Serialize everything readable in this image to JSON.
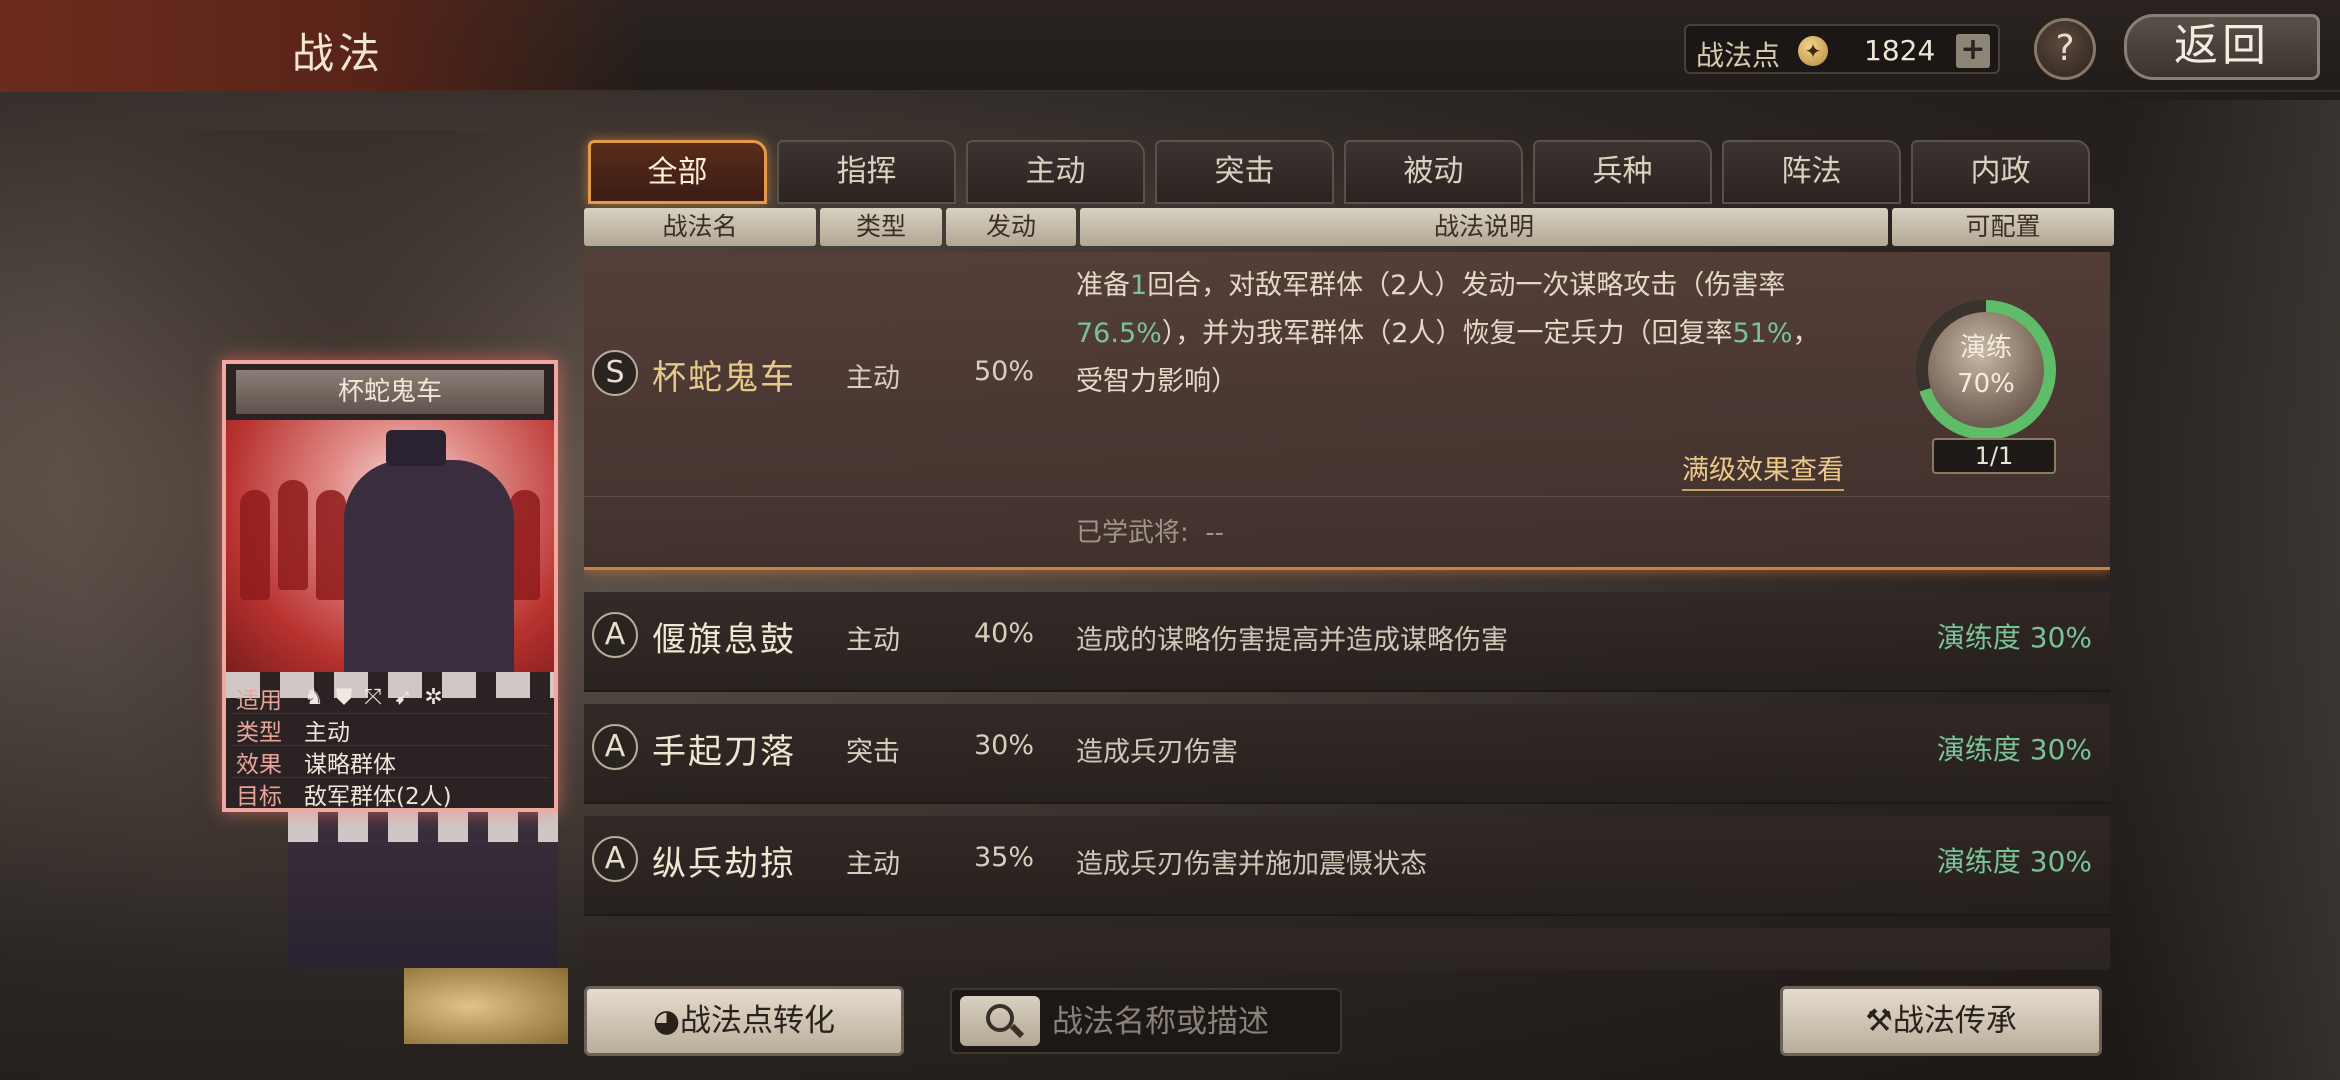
{
  "header": {
    "title": "战法",
    "points_label": "战法点",
    "points_icon": "coin-icon",
    "points_value": "1824",
    "plus_label": "+",
    "help_label": "?",
    "back_label": "返回"
  },
  "tabs": [
    {
      "label": "全部",
      "active": true
    },
    {
      "label": "指挥",
      "active": false
    },
    {
      "label": "主动",
      "active": false
    },
    {
      "label": "突击",
      "active": false
    },
    {
      "label": "被动",
      "active": false
    },
    {
      "label": "兵种",
      "active": false
    },
    {
      "label": "阵法",
      "active": false
    },
    {
      "label": "内政",
      "active": false
    }
  ],
  "columns": {
    "name": "战法名",
    "type": "类型",
    "rate": "发动",
    "desc": "战法说明",
    "config": "可配置"
  },
  "card": {
    "title": "杯蛇鬼车",
    "rows": [
      {
        "key": "适用",
        "icons": [
          "horse-icon",
          "shield-icon",
          "bow-icon",
          "spear-icon",
          "wheel-icon"
        ]
      },
      {
        "key": "类型",
        "value": "主动"
      },
      {
        "key": "效果",
        "value": "谋略群体"
      },
      {
        "key": "目标",
        "value": "敌军群体(2人)"
      }
    ]
  },
  "selected": {
    "grade": "S",
    "name": "杯蛇鬼车",
    "type": "主动",
    "rate": "50%",
    "desc_parts": [
      "准备",
      "1",
      "回合，对敌军群体（2人）发动一次谋略攻击（伤害率",
      "76.5%",
      "），并为我军群体（2人）恢复一定兵力（回复率",
      "51%",
      "，受智力影响）"
    ],
    "practice_label": "演练",
    "practice_value": "70%",
    "practice_fraction": 0.7,
    "count": "1/1",
    "view_max": "满级效果查看",
    "learned_label": "已学武将:",
    "learned_value": "--"
  },
  "skills": [
    {
      "grade": "A",
      "name": "偃旗息鼓",
      "type": "主动",
      "rate": "40%",
      "desc": "造成的谋略伤害提高并造成谋略伤害",
      "progress": "演练度 30%"
    },
    {
      "grade": "A",
      "name": "手起刀落",
      "type": "突击",
      "rate": "30%",
      "desc": "造成兵刃伤害",
      "progress": "演练度 30%"
    },
    {
      "grade": "A",
      "name": "纵兵劫掠",
      "type": "主动",
      "rate": "35%",
      "desc": "造成兵刃伤害并施加震慑状态",
      "progress": "演练度 30%"
    }
  ],
  "footer": {
    "convert_label": "战法点转化",
    "search_placeholder": "战法名称或描述",
    "inherit_label": "战法传承"
  },
  "colors": {
    "accent_orange": "#e39a4a",
    "progress_green": "#79c496",
    "gold_name": "#e6c98a"
  }
}
